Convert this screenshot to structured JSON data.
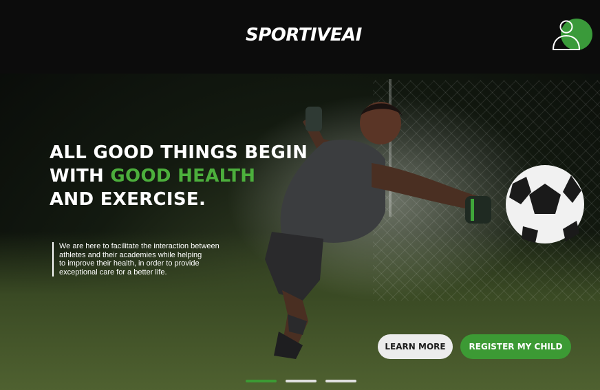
{
  "header": {
    "logo_main": "SPORTIVE",
    "logo_suffix": "AI",
    "user_icon": "user-icon"
  },
  "hero": {
    "headline_line1": "ALL GOOD THINGS BEGIN",
    "headline_line2_prefix": "WITH ",
    "headline_line2_accent": "GOOD HEALTH",
    "headline_line3": "AND EXERCISE.",
    "intro_lines": [
      "We are here to facilitate the interaction between",
      "athletes and their academies while helping",
      "to improve their health, in order to provide",
      "exceptional care for a better life."
    ],
    "learn_more_label": "LEARN MORE",
    "register_label": "REGISTER MY CHILD"
  },
  "carousel": {
    "slides": 3,
    "active_index": 0
  },
  "colors": {
    "accent": "#3c9a34",
    "header_bg": "#0c0c0c",
    "text": "#ffffff"
  }
}
